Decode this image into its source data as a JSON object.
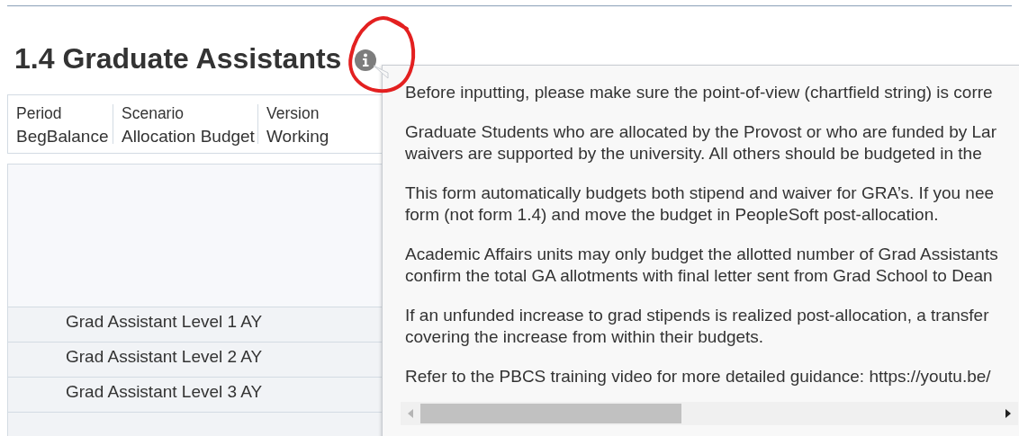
{
  "title": "1.4 Graduate Assistants",
  "pov": [
    {
      "label": "Period",
      "value": "BegBalance"
    },
    {
      "label": "Scenario",
      "value": "Allocation Budget"
    },
    {
      "label": "Version",
      "value": "Working"
    }
  ],
  "rows": [
    "Grad Assistant Level 1 AY",
    "Grad Assistant Level 2 AY",
    "Grad Assistant Level 3 AY"
  ],
  "popover": {
    "paragraphs": [
      [
        "Before inputting, please make sure the point-of-view (chartfield string) is corre"
      ],
      [
        "Graduate Students who are allocated by the Provost or who are funded by Lar",
        "waivers are supported by the university. All others should be budgeted in the"
      ],
      [
        "This form automatically budgets both stipend and waiver for GRA’s. If you nee",
        "form (not form 1.4) and move the budget in PeopleSoft post-allocation."
      ],
      [
        "Academic Affairs units may only budget the allotted number of Grad Assistants",
        "confirm the total GA allotments with final letter sent from Grad School to Dean"
      ],
      [
        "If an unfunded increase to grad stipends is realized post-allocation, a transfer",
        "covering the increase from within their budgets."
      ],
      [
        "Refer to the PBCS training video for more detailed guidance: https://youtu.be/"
      ]
    ]
  }
}
